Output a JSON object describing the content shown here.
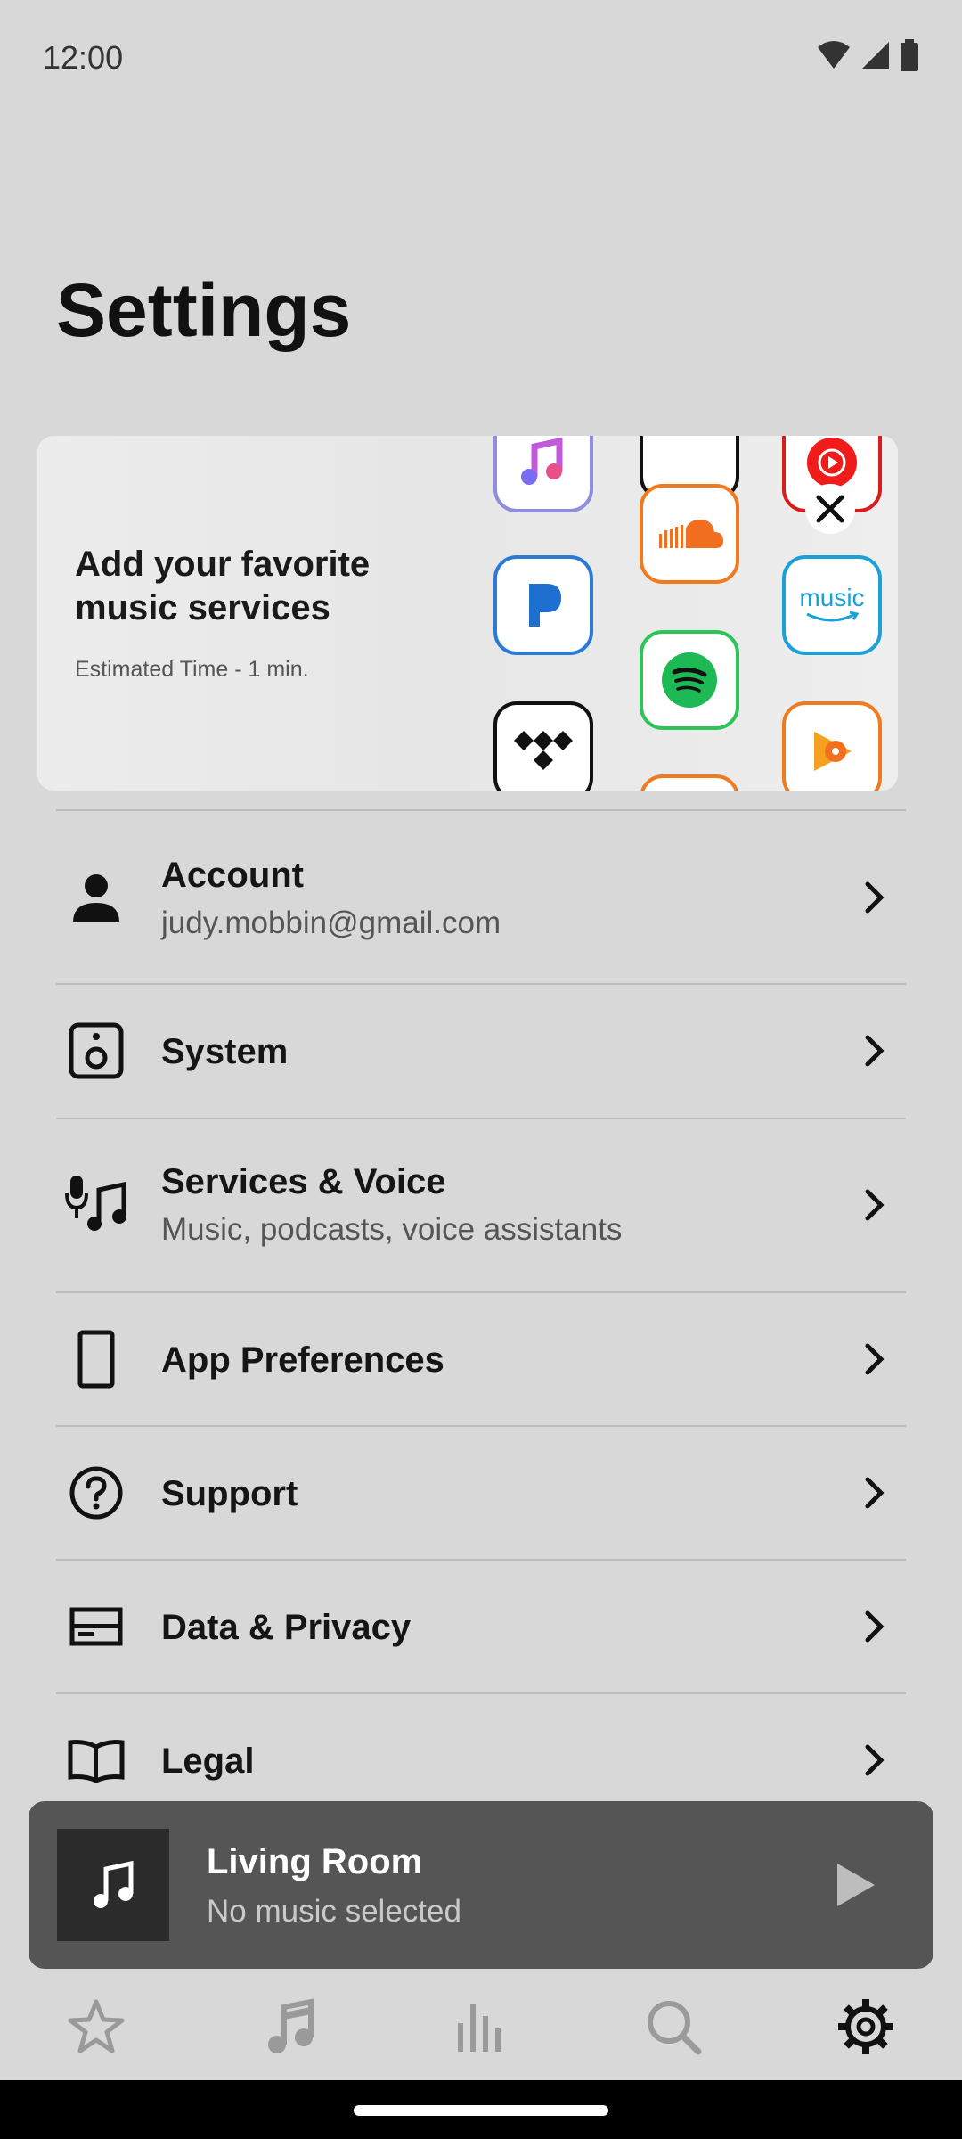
{
  "status": {
    "time": "12:00",
    "icons": [
      "wifi-icon",
      "signal-icon",
      "battery-icon"
    ]
  },
  "page_title": "Settings",
  "promo": {
    "title": "Add your favorite music services",
    "subtitle": "Estimated Time - 1 min.",
    "services": [
      "Apple Music",
      "Pandora",
      "Tidal",
      "SoundCloud",
      "Spotify",
      "YouTube Music",
      "Amazon Music",
      "Google Play Music"
    ],
    "amazon_label": "music"
  },
  "menu": {
    "account": {
      "title": "Account",
      "subtitle": "judy.mobbin@gmail.com"
    },
    "system": {
      "title": "System"
    },
    "services": {
      "title": "Services & Voice",
      "subtitle": "Music, podcasts, voice assistants"
    },
    "app_prefs": {
      "title": "App Preferences"
    },
    "support": {
      "title": "Support"
    },
    "privacy": {
      "title": "Data & Privacy"
    },
    "legal": {
      "title": "Legal"
    }
  },
  "player": {
    "room": "Living Room",
    "status": "No music selected"
  },
  "nav": [
    "favorites-icon",
    "music-icon",
    "rooms-icon",
    "search-icon",
    "settings-icon"
  ],
  "colors": {
    "background": "#d8d8d8",
    "player": "#555555",
    "active_nav": "#111111",
    "inactive_nav": "#9a9a9a"
  }
}
